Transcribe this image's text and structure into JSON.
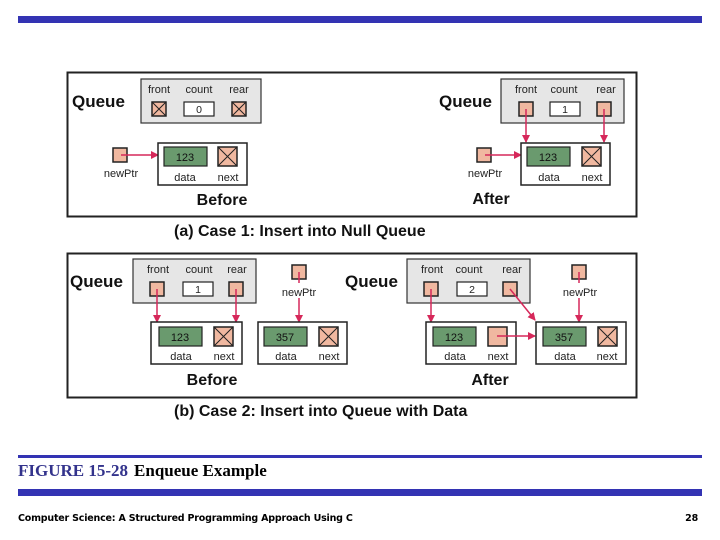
{
  "slide": {
    "figure_number": "FIGURE 15-28",
    "figure_title": "Enqueue Example",
    "footer_text": "Computer Science: A Structured Programming Approach Using C",
    "page_number": "28"
  },
  "colors": {
    "accent_bar": "#3333b3",
    "pointer_fill": "#f0b8a0",
    "data_fill": "#6a9a6e",
    "queue_header_fill": "#e6e6e6",
    "arrow": "#d6285a"
  },
  "labels": {
    "queue": "Queue",
    "front": "front",
    "count": "count",
    "rear": "rear",
    "newPtr": "newPtr",
    "data": "data",
    "next": "next",
    "before": "Before",
    "after": "After"
  },
  "panels": {
    "a": {
      "caption": "(a) Case 1: Insert into Null Queue",
      "before": {
        "count": "0",
        "front": "null",
        "rear": "null",
        "nodes": [
          {
            "data": "123",
            "next": "null"
          }
        ]
      },
      "after": {
        "count": "1",
        "front": "node-123",
        "rear": "node-123",
        "nodes": [
          {
            "data": "123",
            "next": "null"
          }
        ]
      }
    },
    "b": {
      "caption": "(b) Case 2: Insert into Queue with Data",
      "before": {
        "count": "1",
        "front": "node-123",
        "rear": "node-123",
        "nodes": [
          {
            "data": "123",
            "next": "null"
          },
          {
            "data": "357",
            "next": "null"
          }
        ]
      },
      "after": {
        "count": "2",
        "front": "node-123",
        "rear": "node-357",
        "nodes": [
          {
            "data": "123",
            "next": "node-357"
          },
          {
            "data": "357",
            "next": "null"
          }
        ]
      }
    }
  }
}
